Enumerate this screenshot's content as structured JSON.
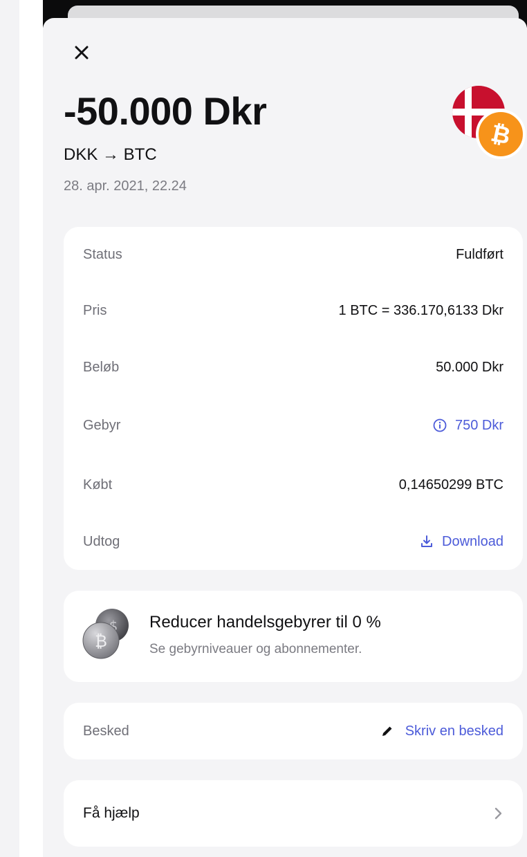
{
  "transaction": {
    "amount": "-50.000 Dkr",
    "pair": "DKK → BTC",
    "datetime": "28. apr. 2021, 22.24"
  },
  "details": [
    {
      "label": "Status",
      "value": "Fuldført"
    },
    {
      "label": "Pris",
      "value": "1 BTC = 336.170,6133 Dkr"
    },
    {
      "label": "Beløb",
      "value": "50.000 Dkr"
    },
    {
      "label": "Gebyr",
      "value": "750 Dkr",
      "icon": "info-icon"
    },
    {
      "label": "Købt",
      "value": "0,14650299 BTC"
    },
    {
      "label": "Udtog",
      "value": "Download",
      "icon": "download-icon"
    }
  ],
  "promo": {
    "title": "Reducer handelsgebyrer til 0 %",
    "subtitle": "Se gebyrniveauer og abonnementer.",
    "icon": "coins-icon"
  },
  "message": {
    "label": "Besked",
    "action": "Skriv en besked",
    "icon": "pencil-icon"
  },
  "help": {
    "label": "Få hjælp",
    "icon": "chevron-right-icon"
  },
  "colors": {
    "accent": "#4c5bd9",
    "flag_red": "#c8102e",
    "btc_orange": "#f7931a",
    "text_primary": "#111113",
    "text_secondary": "#6f6f77"
  }
}
